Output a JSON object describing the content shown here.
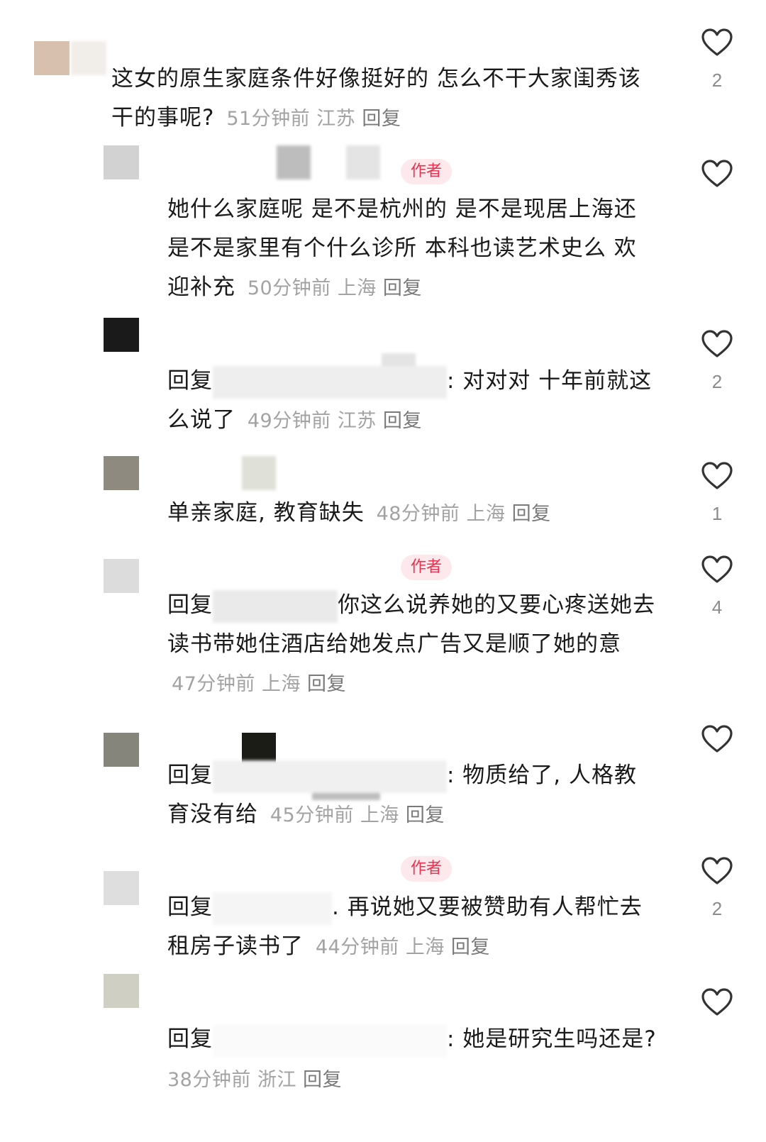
{
  "comments": [
    {
      "text": "这女的原生家庭条件好像挺好的 怎么不干大家闺秀该干的事呢?",
      "time": "51分钟前",
      "location": "江苏",
      "reply": "回复",
      "likes": "2",
      "author": false
    },
    {
      "text": "她什么家庭呢 是不是杭州的 是不是现居上海还是不是家里有个什么诊所 本科也读艺术史么 欢迎补充",
      "time": "50分钟前",
      "location": "上海",
      "reply": "回复",
      "likes": "",
      "author": true
    },
    {
      "prefix": "回复",
      "text": ": 对对对 十年前就这么说了",
      "time": "49分钟前",
      "location": "江苏",
      "reply": "回复",
      "likes": "2",
      "author": false
    },
    {
      "text": "单亲家庭, 教育缺失",
      "time": "48分钟前",
      "location": "上海",
      "reply": "回复",
      "likes": "1",
      "author": false
    },
    {
      "prefix": "回复",
      "text": "你这么说养她的又要心疼送她去读书带她住酒店给她发点广告又是顺了她的意",
      "time": "47分钟前",
      "location": "上海",
      "reply": "回复",
      "likes": "4",
      "author": true
    },
    {
      "prefix": "回复",
      "text": ": 物质给了, 人格教育没有给",
      "time": "45分钟前",
      "location": "上海",
      "reply": "回复",
      "likes": "",
      "author": false
    },
    {
      "prefix": "回复",
      "text": ". 再说她又要被赞助有人帮忙去租房子读书了",
      "time": "44分钟前",
      "location": "上海",
      "reply": "回复",
      "likes": "2",
      "author": true
    },
    {
      "prefix": "回复",
      "text": ": 她是研究生吗还是?",
      "time": "38分钟前",
      "location": "浙江",
      "reply": "回复",
      "likes": "",
      "author": false
    }
  ],
  "author_badge": "作者",
  "icons": {
    "like": "heart-outline-icon"
  },
  "colors": {
    "badge_bg": "#fde9ec",
    "badge_text": "#e8324f",
    "meta": "#a3a3a3"
  }
}
